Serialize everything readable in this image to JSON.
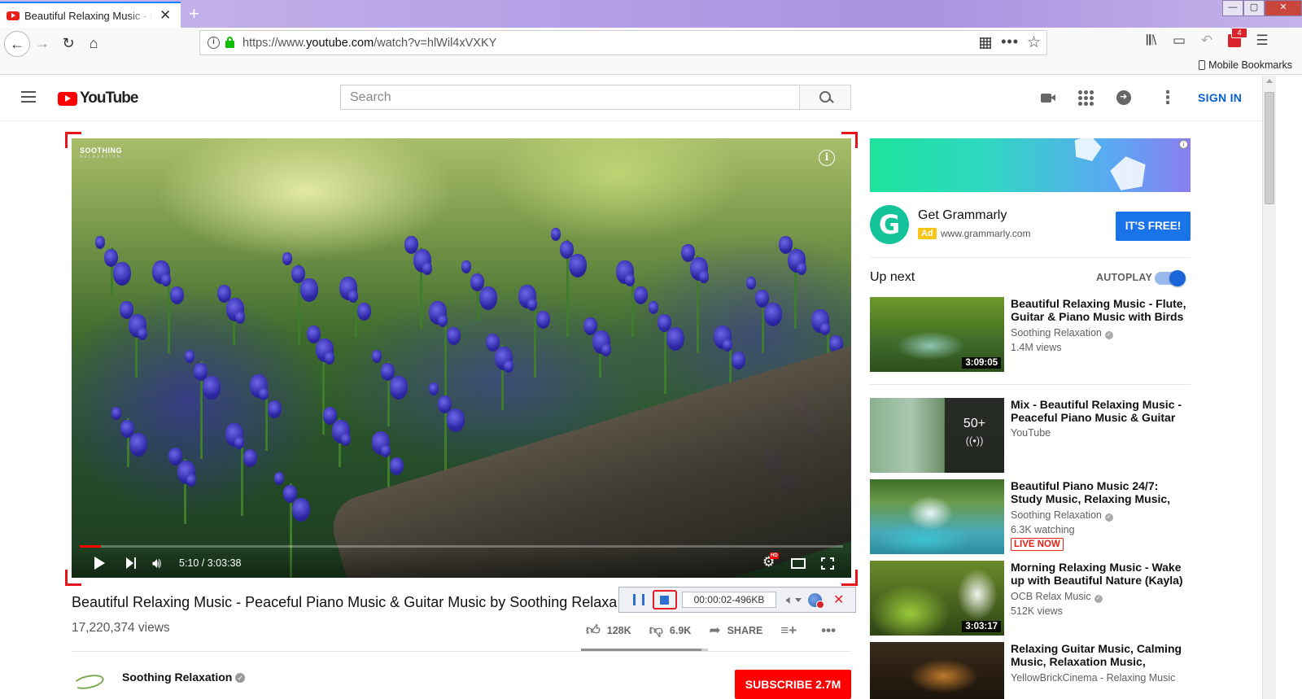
{
  "browser": {
    "tab_title": "Beautiful Relaxing Music - Peaceful Piano Music & Guitar Music",
    "tab_close": "✕",
    "new_tab": "+",
    "url_prefix": "https://www.",
    "url_domain": "youtube.com",
    "url_path": "/watch?v=hlWil4xVXKY",
    "extension_badge": "4",
    "bookmarks_mobile": "Mobile Bookmarks",
    "window_controls": {
      "minimize": "—",
      "maximize": "▢",
      "close": "✕"
    }
  },
  "youtube": {
    "logo_text": "YouTube",
    "search_placeholder": "Search",
    "sign_in": "SIGN IN"
  },
  "player": {
    "channel_watermark": "SOOTHING",
    "channel_watermark_sub": "RELAXATION",
    "info_icon": "i",
    "current_time": "5:10",
    "duration": "3:03:38",
    "time_display": "5:10 / 3:03:38",
    "progress_fraction": 0.028,
    "hd_badge": "HD"
  },
  "recorder": {
    "status": "00:00:02-496KB",
    "close": "✕"
  },
  "video": {
    "title": "Beautiful Relaxing Music - Peaceful Piano Music & Guitar Music by Soothing Relaxation",
    "views": "17,220,374 views",
    "likes": "128K",
    "dislikes": "6.9K",
    "share_label": "SHARE",
    "like_fraction": 0.95,
    "channel_name": "Soothing Relaxation",
    "subscribe_label": "SUBSCRIBE 2.7M"
  },
  "ad": {
    "title": "Get Grammarly",
    "badge": "Ad",
    "url": "www.grammarly.com",
    "cta": "IT'S FREE!",
    "logo_letter": "G",
    "info": "i"
  },
  "upnext": {
    "label": "Up next",
    "autoplay_label": "AUTOPLAY",
    "autoplay_on": true,
    "items": [
      {
        "title": "Beautiful Relaxing Music - Flute, Guitar & Piano Music with Birds",
        "channel": "Soothing Relaxation",
        "verified": true,
        "views": "1.4M views",
        "duration": "3:09:05"
      },
      {
        "title": "Mix - Beautiful Relaxing Music - Peaceful Piano Music & Guitar",
        "channel": "YouTube",
        "verified": false,
        "mix_count": "50+",
        "mix_icon": "((•))"
      },
      {
        "title": "Beautiful Piano Music 24/7: Study Music, Relaxing Music, Sleep Music, Meditation",
        "channel": "Soothing Relaxation",
        "verified": true,
        "views": "6.3K watching",
        "live": "LIVE NOW"
      },
      {
        "title": "Morning Relaxing Music - Wake up with Beautiful Nature (Kayla)",
        "channel": "OCB Relax Music",
        "verified": true,
        "views": "512K views",
        "duration": "3:03:17"
      },
      {
        "title": "Relaxing Guitar Music, Calming Music, Relaxation Music, Meditation Music",
        "channel": "YellowBrickCinema - Relaxing Music",
        "verified": false
      }
    ]
  },
  "colors": {
    "accent_red": "#ff0000",
    "link_blue": "#065fd4",
    "recorder_frame": "#e8141b",
    "grammarly_green": "#15c39a",
    "cta_blue": "#1a73e8"
  }
}
